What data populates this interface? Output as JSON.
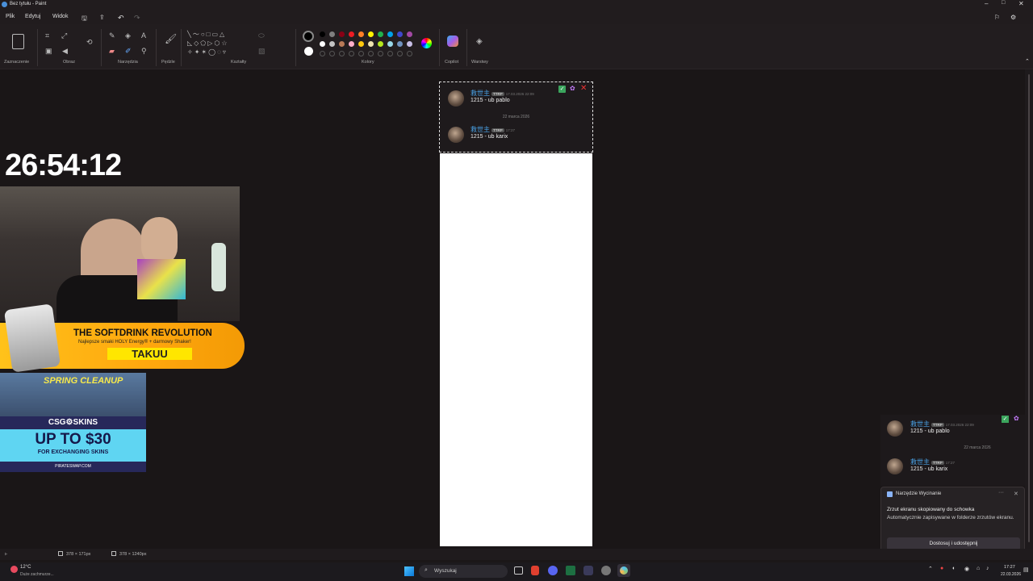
{
  "window": {
    "title": "Bez tytułu - Paint"
  },
  "menu": {
    "file": "Plik",
    "edit": "Edytuj",
    "view": "Widok"
  },
  "ribbon": {
    "groups": {
      "selection": "Zaznaczenie",
      "image": "Obraz",
      "tools": "Narzędzia",
      "brushes": "Pędzle",
      "shapes": "Kształty",
      "colors": "Kolory",
      "copilot": "Copilot",
      "layers": "Warstwy"
    },
    "palette": [
      "#000000",
      "#7f7f7f",
      "#880015",
      "#ed1c24",
      "#ff7f27",
      "#fff200",
      "#22b14c",
      "#00a2e8",
      "#3f48cc",
      "#a349a4",
      "#ffffff",
      "#c3c3c3",
      "#b97a57",
      "#ffaec9",
      "#ffc90e",
      "#efe4b0",
      "#b5e61d",
      "#99d9ea",
      "#7092be",
      "#c8bfe7"
    ]
  },
  "chat": {
    "msg1": {
      "user": "救世主",
      "badge": "TTRP",
      "time": "17.03.2026 22:09",
      "text": "1215 - ub pablo"
    },
    "date_sep": "22 marca 2026",
    "msg2": {
      "user": "救世主",
      "badge": "TTRP",
      "time": "17:27",
      "text": "1215 - ub karix"
    }
  },
  "overlay": {
    "timer": "26:54:12",
    "banner1_title": "THE SOFTDRINK REVOLUTION",
    "banner1_sub": "Najlepsze smaki HOLY Energy® + darmowy Shaker!",
    "banner1_code": "TAKUU",
    "banner2_title": "SPRING CLEANUP",
    "banner2_brand": "CSG⚙SKINS",
    "banner2_amount": "UP TO $30",
    "banner2_sub": "FOR EXCHANGING SKINS",
    "banner2_site": "PIRATESWAP.COM"
  },
  "status": {
    "selection_size": "378 × 171px",
    "canvas_size": "378 × 1240px"
  },
  "toast": {
    "app": "Narzędzie Wycinanie",
    "line1": "Zrzut ekranu skopiowany do schowka",
    "line2": "Automatycznie zapisywane w folderze zrzutów ekranu.",
    "button": "Dostosuj i udostępnij"
  },
  "taskbar": {
    "weather_temp": "12°C",
    "weather_desc": "Duże zachmurze...",
    "search": "Wyszukaj",
    "time": "17:27",
    "date": "22.03.2026"
  }
}
